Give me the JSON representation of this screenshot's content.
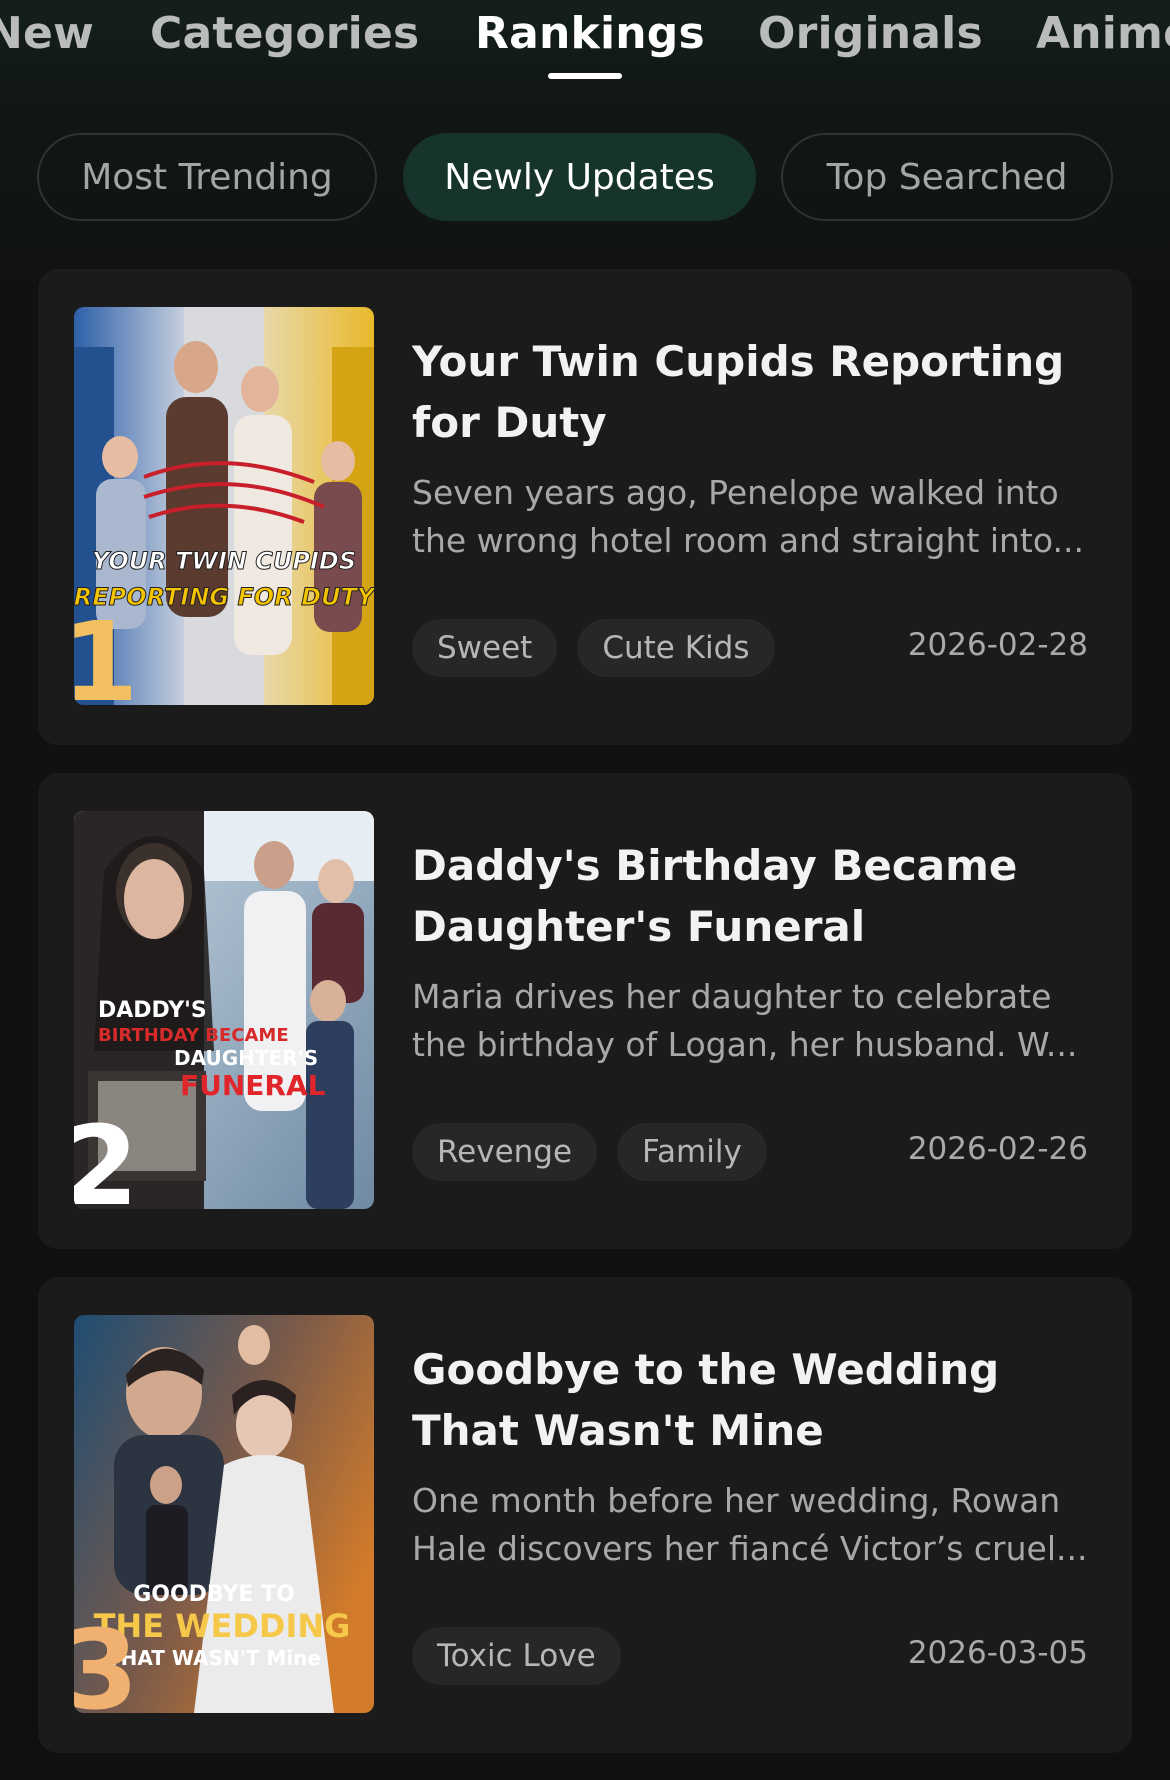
{
  "top_tabs": [
    {
      "label": "New"
    },
    {
      "label": "Categories"
    },
    {
      "label": "Rankings"
    },
    {
      "label": "Originals"
    },
    {
      "label": "Anime"
    }
  ],
  "active_tab": "Rankings",
  "filters": [
    {
      "label": "Most Trending"
    },
    {
      "label": "Newly Updates"
    },
    {
      "label": "Top Searched"
    }
  ],
  "active_filter": "Newly Updates",
  "items": [
    {
      "rank": "1",
      "title": "Your Twin Cupids Reporting for Duty",
      "description": "Seven years ago, Penelope walked into the wrong hotel room and straight into...",
      "tags": [
        "Sweet",
        "Cute Kids"
      ],
      "date": "2026-02-28",
      "poster_text": [
        "YOUR TWIN CUPIDS",
        "REPORTING FOR DUTY"
      ]
    },
    {
      "rank": "2",
      "title": "Daddy's Birthday Became Daughter's Funeral",
      "description": "Maria drives her daughter to celebrate the birthday of Logan, her husband. W...",
      "tags": [
        "Revenge",
        "Family"
      ],
      "date": "2026-02-26",
      "poster_text": [
        "DADDY'S",
        "BIRTHDAY BECAME",
        "DAUGHTER'S",
        "FUNERAL"
      ]
    },
    {
      "rank": "3",
      "title": "Goodbye to the Wedding That Wasn't Mine",
      "description": "One month before her wedding, Rowan Hale discovers her fiancé Victor’s cruel...",
      "tags": [
        "Toxic Love"
      ],
      "date": "2026-03-05",
      "poster_text": [
        "GOODBYE TO",
        "THE WEDDING",
        "THAT WASN'T Mine"
      ]
    }
  ],
  "colors": {
    "background": "#0f1110",
    "card": "#1b1b1b",
    "active_pill": "#16332c",
    "rank1": "#f2c060",
    "rank2": "#ffffff",
    "rank3": "#f0b070"
  }
}
